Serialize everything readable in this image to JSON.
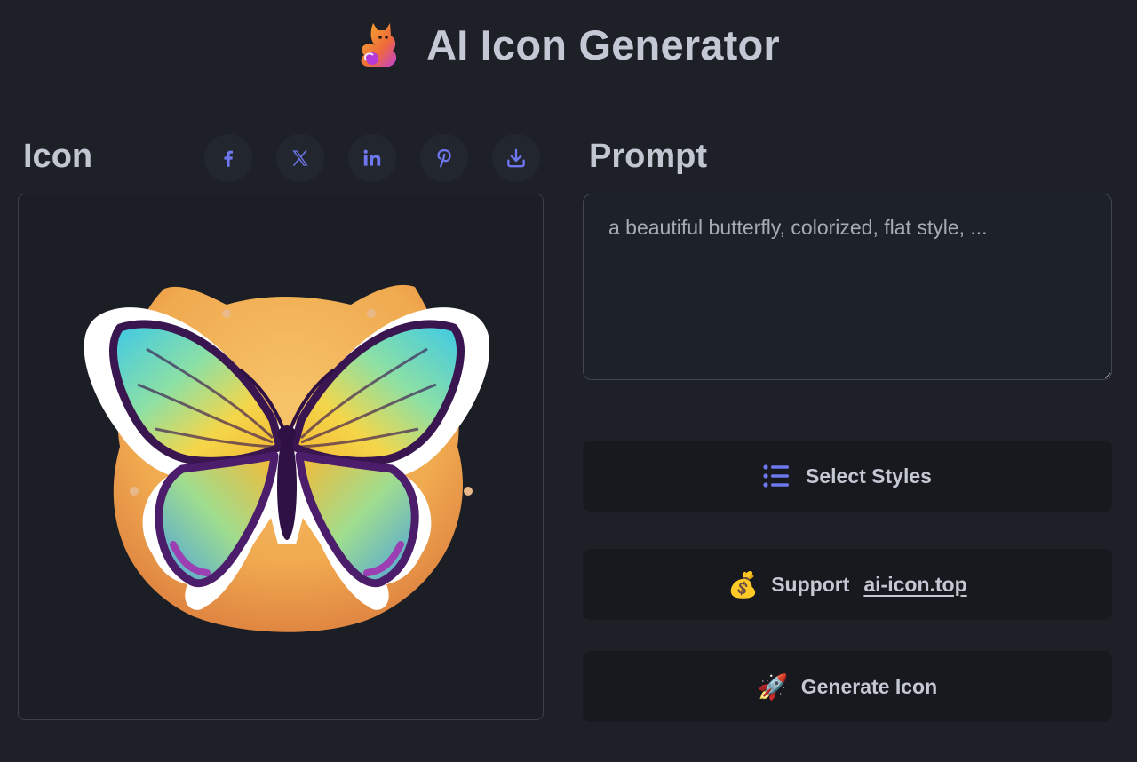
{
  "header": {
    "title": "AI Icon Generator",
    "logo_icon": "cat-logo-icon"
  },
  "icon_panel": {
    "heading": "Icon",
    "share_buttons": [
      {
        "name": "facebook",
        "icon": "facebook-icon"
      },
      {
        "name": "x",
        "icon": "x-icon"
      },
      {
        "name": "linkedin",
        "icon": "linkedin-icon"
      },
      {
        "name": "pinterest",
        "icon": "pinterest-icon"
      },
      {
        "name": "download",
        "icon": "download-icon"
      }
    ],
    "share_icon_color": "#6f77ef",
    "image_subject": "butterfly-sticker"
  },
  "prompt_panel": {
    "heading": "Prompt",
    "input_value": "",
    "input_placeholder": "a beautiful butterfly, colorized, flat style, ..."
  },
  "buttons": {
    "select_styles": {
      "label": "Select Styles",
      "icon": "list-icon"
    },
    "support": {
      "emoji": "💰",
      "label": "Support",
      "link_text": "ai-icon.top"
    },
    "generate": {
      "emoji": "🚀",
      "label": "Generate Icon"
    }
  },
  "colors": {
    "background": "#1d2026",
    "accent": "#6f77ef",
    "button_bg": "#17191e"
  }
}
